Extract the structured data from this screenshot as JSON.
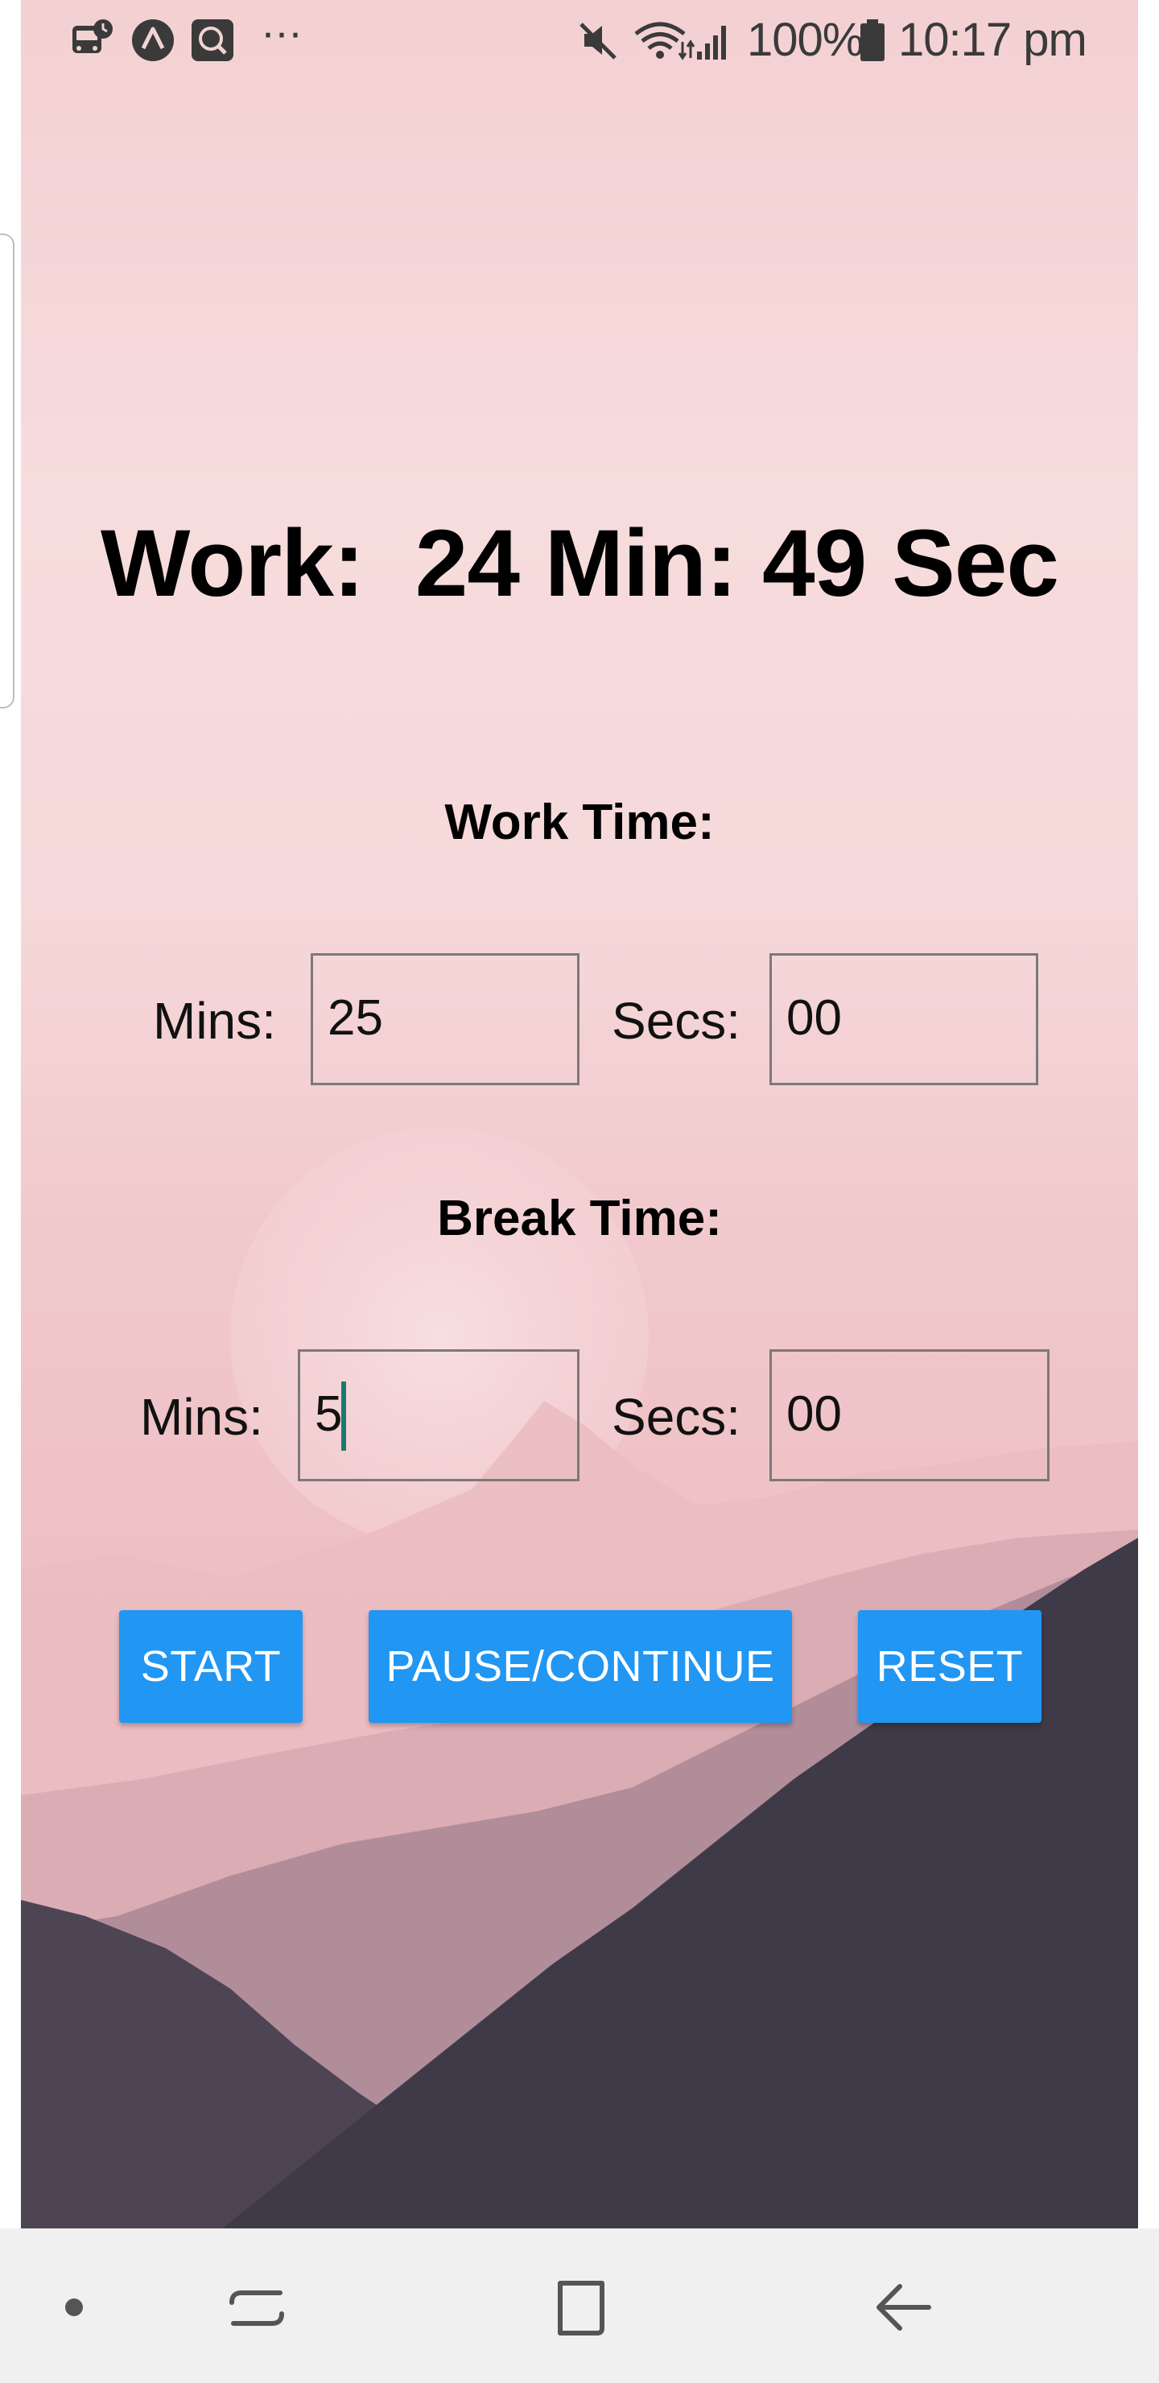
{
  "status_bar": {
    "left_icons": [
      "transit-notification-icon",
      "app-a-notification-icon",
      "chat-notification-icon",
      "more-notifications-icon"
    ],
    "more_dots": "···",
    "right_icons": [
      "mute-icon",
      "wifi-icon",
      "signal-icon",
      "battery-icon"
    ],
    "battery_percent": "100%",
    "time": "10:17 pm"
  },
  "timer": {
    "mode_label": "Work:",
    "minutes": "24",
    "minutes_unit": "Min:",
    "seconds": "49",
    "seconds_unit": "Sec"
  },
  "work_time": {
    "title": "Work Time:",
    "mins_label": "Mins:",
    "mins_value": "25",
    "secs_label": "Secs:",
    "secs_value": "00"
  },
  "break_time": {
    "title": "Break Time:",
    "mins_label": "Mins:",
    "mins_value": "5",
    "secs_label": "Secs:",
    "secs_value": "00"
  },
  "buttons": {
    "start": "START",
    "pause_continue": "PAUSE/CONTINUE",
    "reset": "RESET"
  },
  "nav_bar": {
    "icons": [
      "dot-icon",
      "recents-icon",
      "home-icon",
      "back-icon"
    ]
  },
  "colors": {
    "button_bg": "#2196f3",
    "button_text": "#ffffff",
    "cursor": "#1a7a6e",
    "background_pink": "#f3d0d2",
    "mountains_dark": "#3f3a48"
  }
}
